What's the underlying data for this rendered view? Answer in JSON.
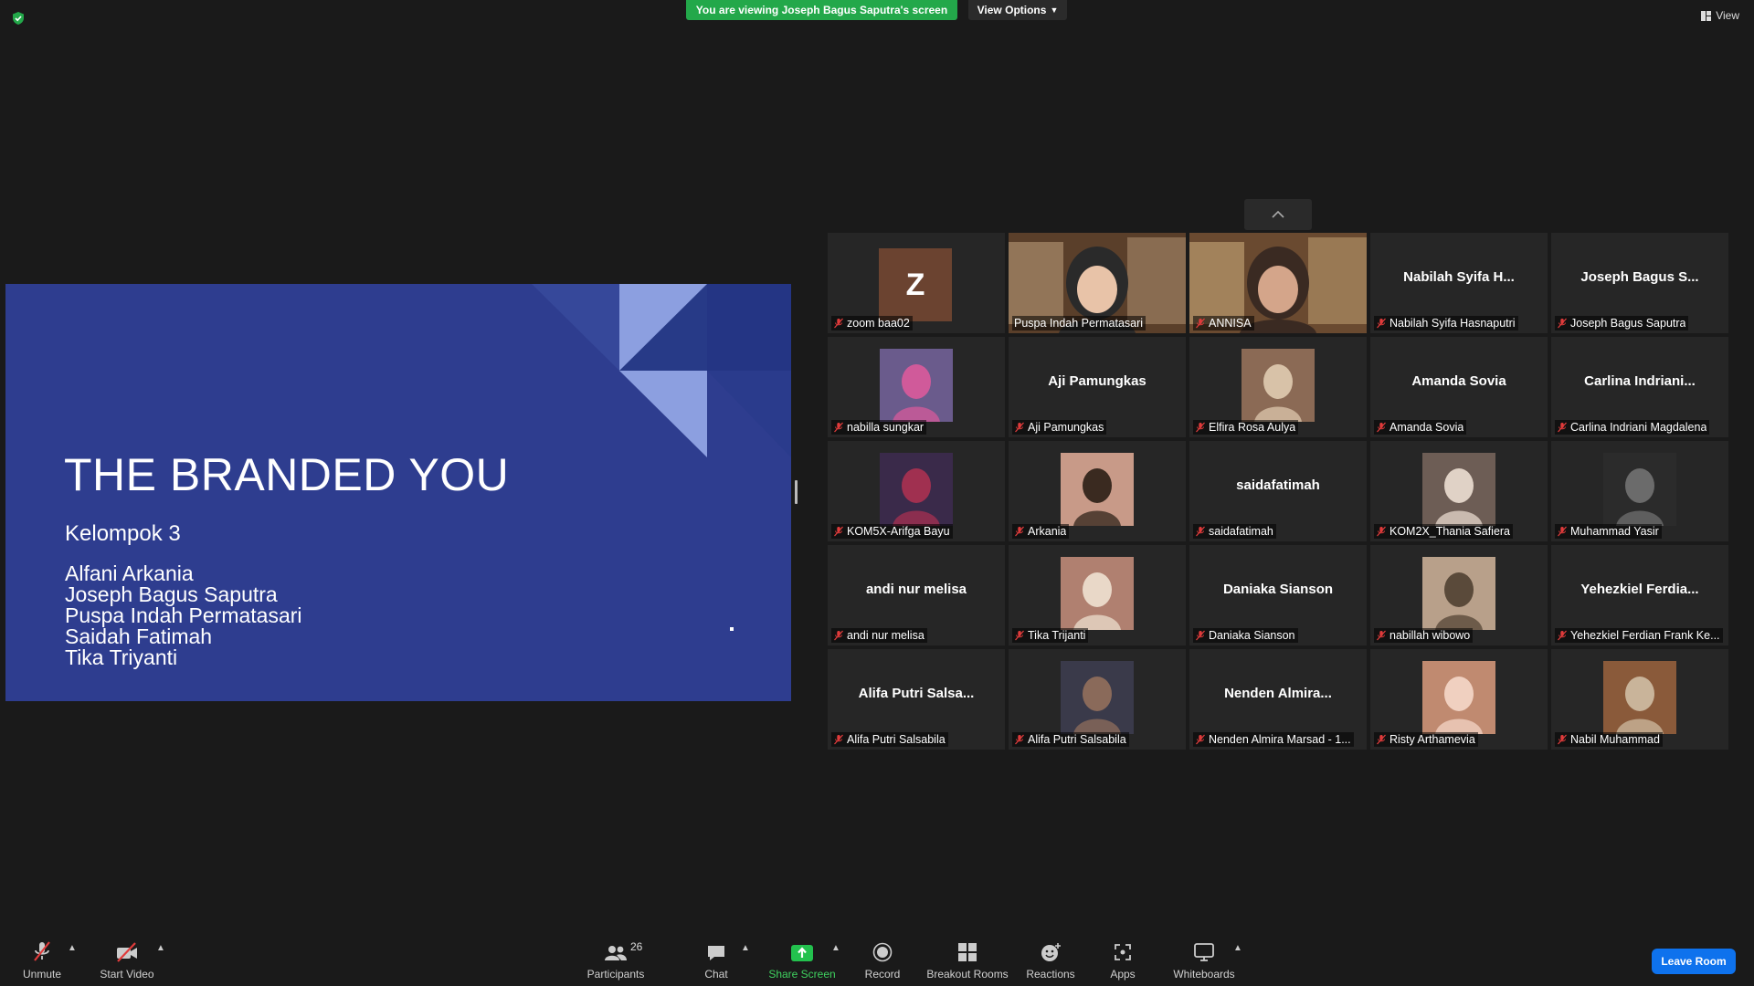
{
  "banner": {
    "viewing_text": "You are viewing Joseph Bagus Saputra's screen",
    "view_options_label": "View Options"
  },
  "view_label": "View",
  "slide": {
    "title": "THE BRANDED YOU",
    "subtitle": "Kelompok 3",
    "members": [
      "Alfani Arkania",
      "Joseph Bagus Saputra",
      "Puspa Indah Permatasari",
      "Saidah Fatimah",
      "Tika Triyanti"
    ]
  },
  "participants_grid": [
    {
      "big_name": "",
      "label": "zoom baa02",
      "kind": "avatar",
      "avatar_letter": "Z",
      "muted": true
    },
    {
      "big_name": "",
      "label": "Puspa Indah Permatasari",
      "kind": "video",
      "active": true,
      "muted": false
    },
    {
      "big_name": "",
      "label": "ANNISA",
      "kind": "video",
      "muted": true
    },
    {
      "big_name": "Nabilah Syifa H...",
      "label": "Nabilah Syifa Hasnaputri",
      "kind": "name",
      "muted": true
    },
    {
      "big_name": "Joseph Bagus S...",
      "label": "Joseph Bagus Saputra",
      "kind": "name",
      "muted": true
    },
    {
      "big_name": "",
      "label": "nabilla sungkar",
      "kind": "photo",
      "muted": true
    },
    {
      "big_name": "Aji Pamungkas",
      "label": "Aji Pamungkas",
      "kind": "name",
      "muted": true
    },
    {
      "big_name": "",
      "label": "Elfira Rosa Aulya",
      "kind": "photo",
      "muted": true
    },
    {
      "big_name": "Amanda Sovia",
      "label": "Amanda Sovia",
      "kind": "name",
      "muted": true
    },
    {
      "big_name": "Carlina  Indriani...",
      "label": "Carlina Indriani Magdalena",
      "kind": "name",
      "muted": true
    },
    {
      "big_name": "",
      "label": "KOM5X-Arifga Bayu",
      "kind": "photo",
      "muted": true
    },
    {
      "big_name": "",
      "label": "Arkania",
      "kind": "photo",
      "muted": true
    },
    {
      "big_name": "saidafatimah",
      "label": "saidafatimah",
      "kind": "name",
      "muted": true
    },
    {
      "big_name": "",
      "label": "KOM2X_Thania Safiera",
      "kind": "photo",
      "muted": true
    },
    {
      "big_name": "",
      "label": "Muhammad Yasir",
      "kind": "photo",
      "muted": true
    },
    {
      "big_name": "andi nur melisa",
      "label": "andi nur melisa",
      "kind": "name",
      "muted": true
    },
    {
      "big_name": "",
      "label": "Tika Trijanti",
      "kind": "photo",
      "muted": true
    },
    {
      "big_name": "Daniaka Sianson",
      "label": "Daniaka Sianson",
      "kind": "name",
      "muted": true
    },
    {
      "big_name": "",
      "label": "nabillah wibowo",
      "kind": "photo",
      "muted": true
    },
    {
      "big_name": "Yehezkiel  Ferdia...",
      "label": "Yehezkiel Ferdian Frank Ke...",
      "kind": "name",
      "muted": true
    },
    {
      "big_name": "Alifa Putri Salsa...",
      "label": "Alifa Putri Salsabila",
      "kind": "name",
      "muted": true
    },
    {
      "big_name": "",
      "label": "Alifa Putri Salsabila",
      "kind": "photo",
      "muted": true
    },
    {
      "big_name": "Nenden  Almira...",
      "label": "Nenden Almira Marsad - 1...",
      "kind": "name",
      "muted": true
    },
    {
      "big_name": "",
      "label": "Risty Arthamevia",
      "kind": "photo",
      "muted": true
    },
    {
      "big_name": "",
      "label": "Nabil Muhammad",
      "kind": "photo",
      "muted": true
    }
  ],
  "toolbar": {
    "unmute": "Unmute",
    "start_video": "Start Video",
    "participants": "Participants",
    "participants_count": "26",
    "chat": "Chat",
    "share_screen": "Share Screen",
    "record": "Record",
    "breakout_rooms": "Breakout Rooms",
    "reactions": "Reactions",
    "apps": "Apps",
    "whiteboards": "Whiteboards",
    "leave_room": "Leave Room"
  },
  "colors": {
    "share_green": "#23a84a",
    "leave_blue": "#0e72ed",
    "slide_bg": "#2e3d8f",
    "active_speaker": "#d8e36a"
  }
}
